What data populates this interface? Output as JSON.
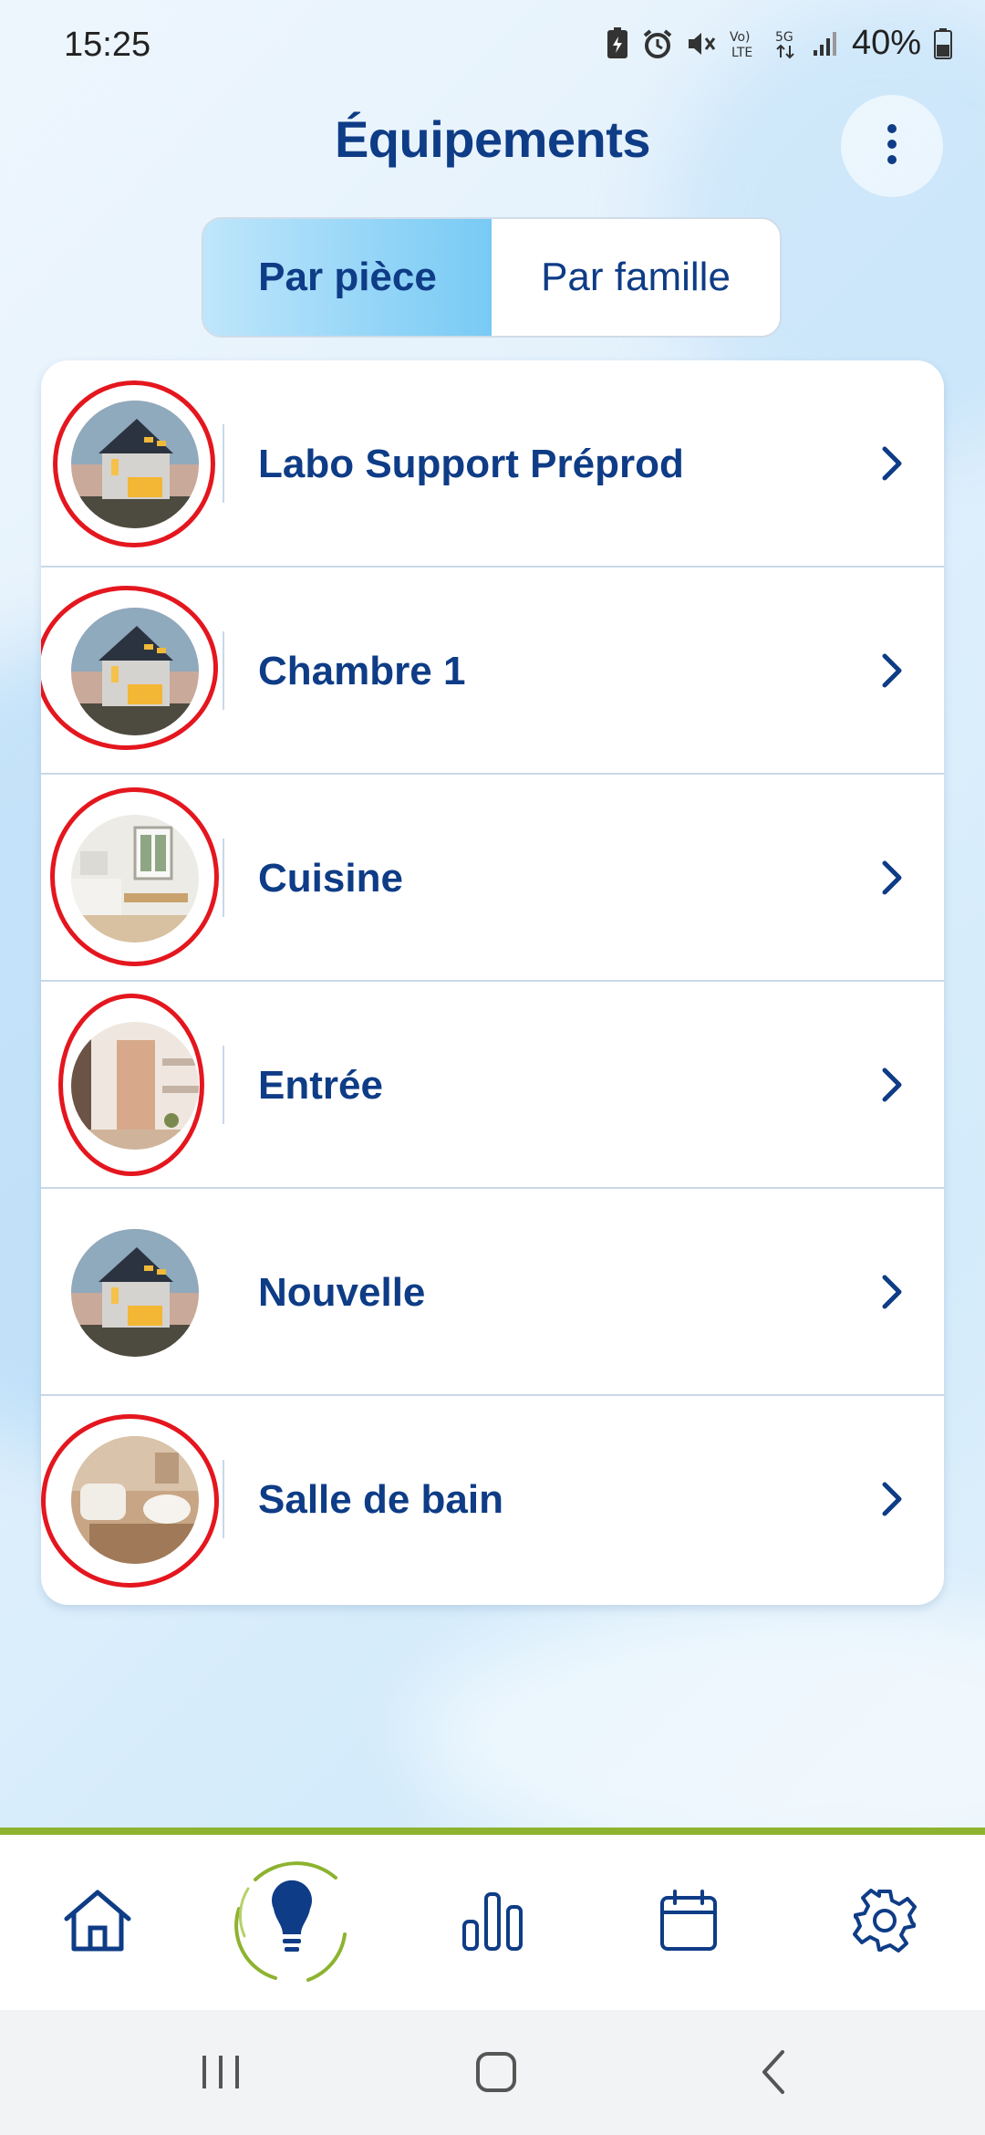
{
  "status_bar": {
    "time": "15:25",
    "battery_percent": "40%",
    "icons": [
      "battery-saver-icon",
      "alarm-icon",
      "mute-icon",
      "volte-icon",
      "5g-icon",
      "signal-icon",
      "battery-icon"
    ]
  },
  "header": {
    "title": "Équipements",
    "menu_icon": "more-vertical-icon"
  },
  "tabs": [
    {
      "label": "Par pièce",
      "active": true
    },
    {
      "label": "Par famille",
      "active": false
    }
  ],
  "rooms": [
    {
      "name": "Labo Support Préprod",
      "image": "house-exterior",
      "highlighted": true
    },
    {
      "name": "Chambre 1",
      "image": "house-exterior",
      "highlighted": true
    },
    {
      "name": "Cuisine",
      "image": "kitchen-interior",
      "highlighted": true
    },
    {
      "name": "Entrée",
      "image": "entrance-interior",
      "highlighted": true
    },
    {
      "name": "Nouvelle",
      "image": "house-exterior",
      "highlighted": false
    },
    {
      "name": "Salle de bain",
      "image": "bathroom-interior",
      "highlighted": true
    }
  ],
  "bottom_nav": [
    {
      "icon": "home-icon",
      "active": false
    },
    {
      "icon": "lightbulb-icon",
      "active": true
    },
    {
      "icon": "bar-chart-icon",
      "active": false
    },
    {
      "icon": "calendar-icon",
      "active": false
    },
    {
      "icon": "settings-gear-icon",
      "active": false
    }
  ],
  "colors": {
    "primary": "#0e3c86",
    "active_tab": "#78caf5",
    "highlight_ring": "#e4161e",
    "nav_accent": "#8db32f"
  }
}
